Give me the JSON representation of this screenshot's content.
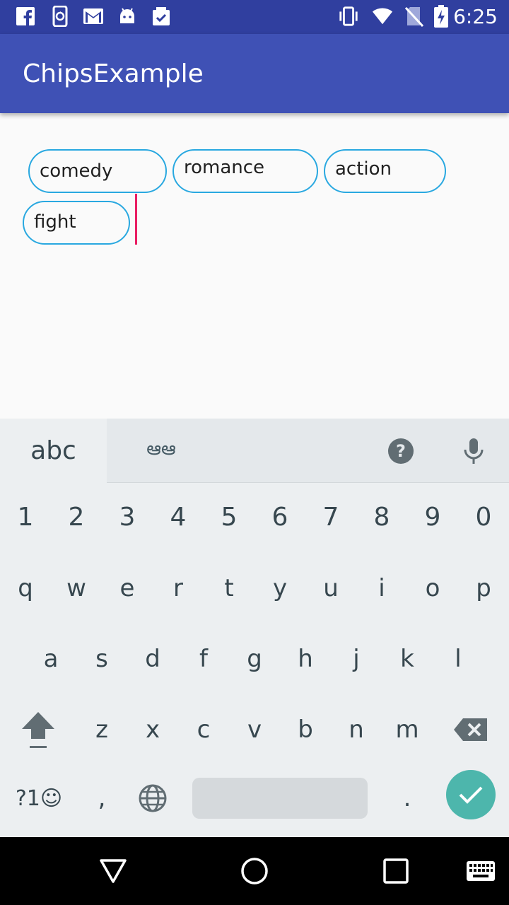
{
  "status_bar": {
    "time": "6:25",
    "icons": [
      "facebook-icon",
      "phone-sync-icon",
      "gmail-icon",
      "android-icon",
      "clipboard-check-icon",
      "vibrate-icon",
      "wifi-icon",
      "no-sim-icon",
      "battery-charging-icon"
    ]
  },
  "app_bar": {
    "title": "ChipsExample"
  },
  "chips": [
    "comedy",
    "romance",
    "action",
    "fight"
  ],
  "keyboard": {
    "tabs": {
      "abc": "abc",
      "script": "ఆఆ"
    },
    "row_numbers": [
      "1",
      "2",
      "3",
      "4",
      "5",
      "6",
      "7",
      "8",
      "9",
      "0"
    ],
    "row1": [
      "q",
      "w",
      "e",
      "r",
      "t",
      "y",
      "u",
      "i",
      "o",
      "p"
    ],
    "row2": [
      "a",
      "s",
      "d",
      "f",
      "g",
      "h",
      "j",
      "k",
      "l"
    ],
    "row3": [
      "z",
      "x",
      "c",
      "v",
      "b",
      "n",
      "m"
    ],
    "symbols_label": "?1☺",
    "comma": ",",
    "period": ".",
    "accent_color": "#4db6ac"
  },
  "colors": {
    "status_bar": "#303f9f",
    "app_bar": "#3f51b5",
    "chip_border": "#29a8e0",
    "cursor": "#e91e63"
  }
}
